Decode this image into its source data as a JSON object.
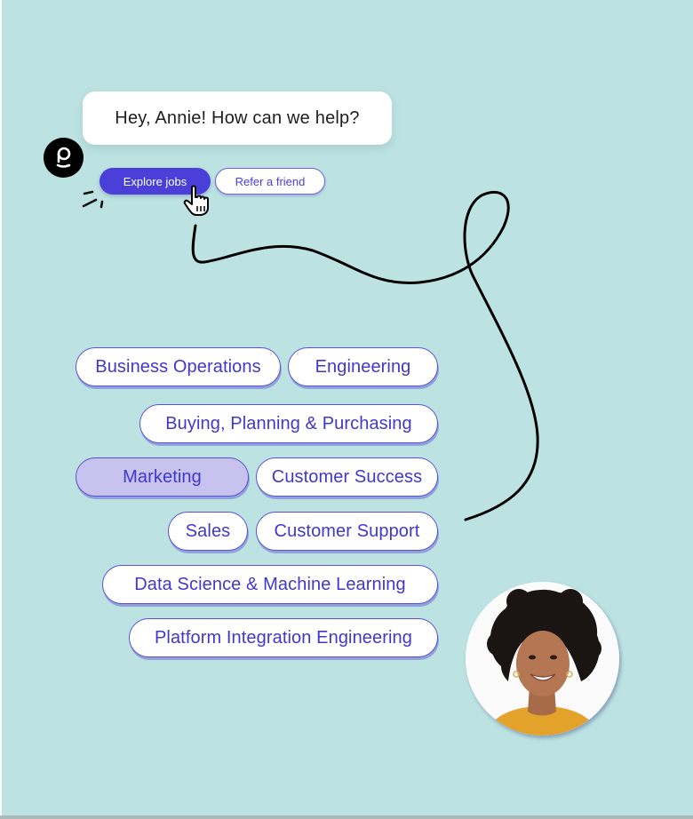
{
  "chat": {
    "greeting": "Hey, Annie! How can we help?",
    "brand_icon": "p-logo-icon"
  },
  "actions": {
    "primary_label": "Explore jobs",
    "secondary_label": "Refer a friend",
    "cursor_icon": "hand-pointer-icon"
  },
  "categories": [
    {
      "label": "Business Operations",
      "selected": false
    },
    {
      "label": "Engineering",
      "selected": false
    },
    {
      "label": "Buying, Planning & Purchasing",
      "selected": false
    },
    {
      "label": "Marketing",
      "selected": true
    },
    {
      "label": "Customer Success",
      "selected": false
    },
    {
      "label": "Sales",
      "selected": false
    },
    {
      "label": "Customer Support",
      "selected": false
    },
    {
      "label": "Data Science & Machine Learning",
      "selected": false
    },
    {
      "label": "Platform Integration Engineering",
      "selected": false
    }
  ],
  "colors": {
    "background": "#bce3e1",
    "accent": "#4a3fd8",
    "pill_text": "#4138c9",
    "selected_pill": "#c8c2ef"
  },
  "avatar": {
    "description": "smiling woman with curly hair, yellow top"
  }
}
